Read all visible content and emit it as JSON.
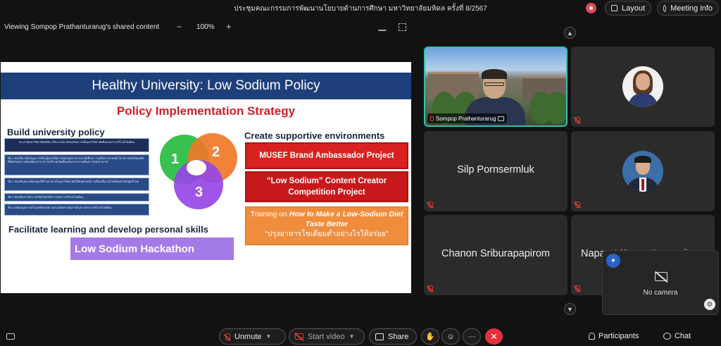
{
  "meeting": {
    "title": "ประชุมคณะกรรมการพัฒนานโยบายด้านการศึกษา มหาวิทยาลัยมหิดล ครั้งที่ 8/2567",
    "layout_label": "Layout",
    "info_label": "Meeting info"
  },
  "share": {
    "label": "Viewing Sompop Prathanturarug's shared content",
    "zoom": "100%",
    "zoom_minus": "−",
    "zoom_plus": "+"
  },
  "slide": {
    "title": "Healthy University: Low Sodium Policy",
    "subtitle": "Policy Implementation Strategy",
    "build_heading": "Build university policy",
    "create_heading": "Create supportive environments",
    "facilitate_heading": "Facilitate learning and develop personal skills",
    "policy_list": [
      "ประกาศมหาวิทยาลัยมหิดล เรื่อง นโยบายส่งเสริมการเป็นมหาวิทยาลัยต้นแบบการบริโภคโซเดียม",
      "ข้อ 1 ส่งเสริม สนับสนุนการเรียนรู้และให้ความรู้แก่บุคลากร และนักศึกษา รวมถึงประชาชนทั่วไป ตระหนักถึงผลเสียที่เกิดกับสุขภาพอันเนื่องมาจากการบริโภคโซเดียมเกินกว่าความต้องการของร่างกาย",
      "ข้อ 2 ส่งเสริมและสนับสนุนให้ร้านอาหารในมหาวิทยาลัยใช้สัญลักษณ์การเลือกปริมาณโซเดียมสำหรับผู้บริโภค",
      "ข้อ 3 ส่งเสริมการทำงานวิจัยในหัวข้อการลดการบริโภคโซเดียม",
      "ข้อ 4 สนับสนุนการสร้างเครือข่ายความร่วมมือทางสุขภาพในการลดการบริโภคโซเดียม"
    ],
    "venn": [
      "1",
      "2",
      "3"
    ],
    "project_1": "MUSEF Brand Ambassador Project",
    "project_2": "“Low Sodium” Content Creator Competition Project",
    "training_prefix": "Training on ",
    "training_italic": "How to Make a Low-Sodium Diet Taste Better",
    "training_thai": "“ปรุงอาหารโซเดียมต่ำอย่างไรให้อร่อย”",
    "hackathon": "Low Sodium Hackathon"
  },
  "participants": [
    {
      "name": "Sompop Prathanturarug",
      "video": true
    },
    {
      "name": "",
      "video": false,
      "avatar": "woman"
    },
    {
      "name": "Silp Pornsermluk",
      "video": false
    },
    {
      "name": "",
      "video": false,
      "avatar": "man"
    },
    {
      "name": "Chanon Sriburapapirom",
      "video": false
    },
    {
      "name": "Naparat Kranrattanasuit",
      "video": false
    }
  ],
  "self_view": {
    "status": "No camera"
  },
  "controls": {
    "unmute": "Unmute",
    "start_video": "Start video",
    "share": "Share",
    "participants": "Participants",
    "chat": "Chat",
    "more": "···",
    "end": "✕"
  },
  "colors": {
    "accent_active": "#32c1b0",
    "end_call": "#e5303c",
    "slide_header": "#1f3f7a"
  }
}
